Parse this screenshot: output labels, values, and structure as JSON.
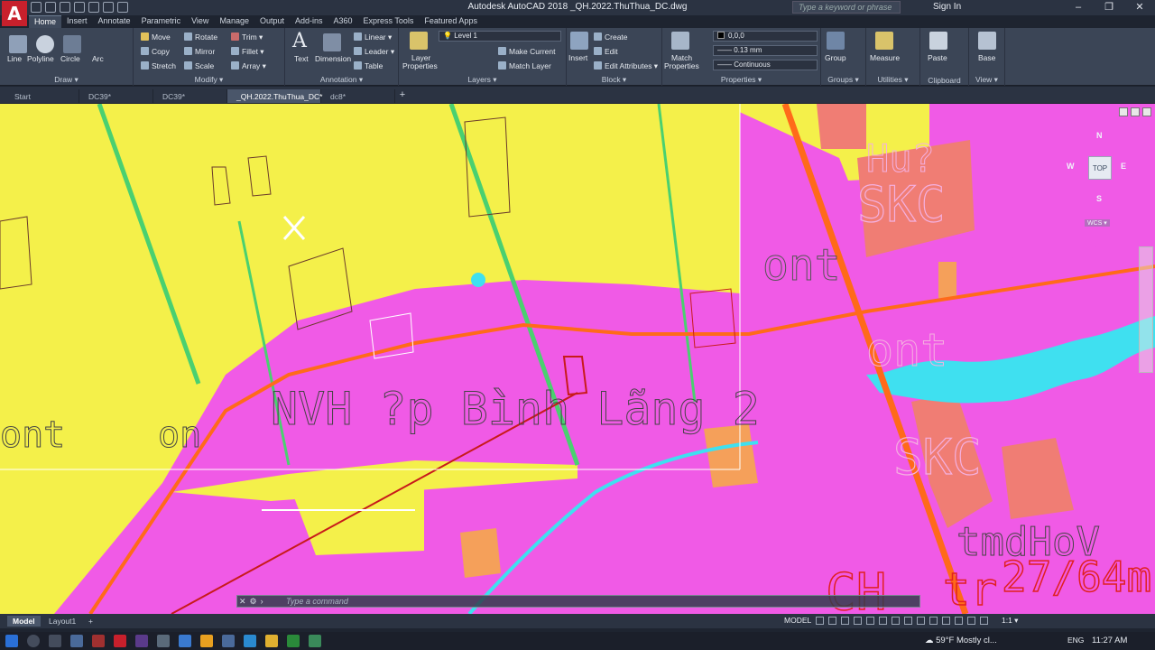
{
  "app": {
    "title": "Autodesk AutoCAD 2018    _QH.2022.ThuThua_DC.dwg",
    "logo": "A",
    "search_placeholder": "Type a keyword or phrase",
    "signin": "Sign In"
  },
  "ribbon_tabs": [
    "Home",
    "Insert",
    "Annotate",
    "Parametric",
    "View",
    "Manage",
    "Output",
    "Add-ins",
    "A360",
    "Express Tools",
    "Featured Apps"
  ],
  "ribbon": {
    "draw": {
      "title": "Draw ▾",
      "line": "Line",
      "polyline": "Polyline",
      "circle": "Circle",
      "arc": "Arc"
    },
    "modify": {
      "title": "Modify ▾",
      "move": "Move",
      "rotate": "Rotate",
      "trim": "Trim ▾",
      "copy": "Copy",
      "mirror": "Mirror",
      "fillet": "Fillet ▾",
      "stretch": "Stretch",
      "scale": "Scale",
      "array": "Array ▾"
    },
    "annotation": {
      "title": "Annotation ▾",
      "text": "Text",
      "dimension": "Dimension",
      "linear": "Linear ▾",
      "leader": "Leader ▾",
      "table": "Table"
    },
    "layers": {
      "title": "Layers ▾",
      "layer_properties_1": "Layer",
      "layer_properties_2": "Properties",
      "current_layer": "Level 1",
      "make_current": "Make Current",
      "match_layer": "Match Layer"
    },
    "block": {
      "title": "Block ▾",
      "insert": "Insert",
      "create": "Create",
      "edit": "Edit",
      "edit_attributes": "Edit Attributes ▾"
    },
    "properties": {
      "title": "Properties ▾",
      "match_1": "Match",
      "match_2": "Properties",
      "color": "0,0,0",
      "lineweight": "0.13 mm",
      "linetype": "Continuous"
    },
    "groups": {
      "title": "Groups ▾",
      "group": "Group"
    },
    "utilities": {
      "title": "Utilities ▾",
      "measure": "Measure"
    },
    "clipboard": {
      "title": "Clipboard",
      "paste": "Paste"
    },
    "view": {
      "title": "View ▾",
      "base": "Base"
    }
  },
  "doc_tabs": [
    "Start",
    "DC39*",
    "DC39*",
    "_QH.2022.ThuThua_DC*",
    "dc8*"
  ],
  "viewport": {
    "viewcube_top": "TOP",
    "compass": {
      "n": "N",
      "s": "S",
      "e": "E",
      "w": "W"
    },
    "wcs": "WCS ▾",
    "map_labels": [
      {
        "text": "SKC",
        "color": "#f4b0e0"
      },
      {
        "text": "ont",
        "color": "#555555"
      },
      {
        "text": "Hu?",
        "color": "#f4b0e0"
      },
      {
        "text": "NVH ?p Bình Lãng 2",
        "color": "#444444"
      },
      {
        "text": "ont",
        "color": "#f4b0e0"
      },
      {
        "text": "SKC",
        "color": "#f4b0e0"
      },
      {
        "text": "tmdHoV",
        "color": "#444444"
      },
      {
        "text": "CH",
        "color": "#e02020"
      },
      {
        "text": "tr",
        "color": "#e02020"
      },
      {
        "text": "27/64m",
        "color": "#e02020"
      },
      {
        "text": "on",
        "color": "#444444"
      },
      {
        "text": "ont",
        "color": "#444444"
      }
    ],
    "command_placeholder": "Type a command"
  },
  "layout_tabs": [
    "Model",
    "Layout1"
  ],
  "status": {
    "model": "MODEL",
    "scale": "1:1 ▾"
  },
  "taskbar": {
    "weather": "59°F  Mostly cl...",
    "lang": "ENG",
    "time": "11:27 AM"
  },
  "colors": {
    "map_yellow": "#f4f04a",
    "map_magenta": "#f05ae6",
    "map_salmon": "#f07d74",
    "map_cyan": "#3fe0f0",
    "map_orange": "#f5a05a",
    "road_orange": "#ff6a1a",
    "road_red": "#c81a1a",
    "green_line": "#4ad070"
  }
}
